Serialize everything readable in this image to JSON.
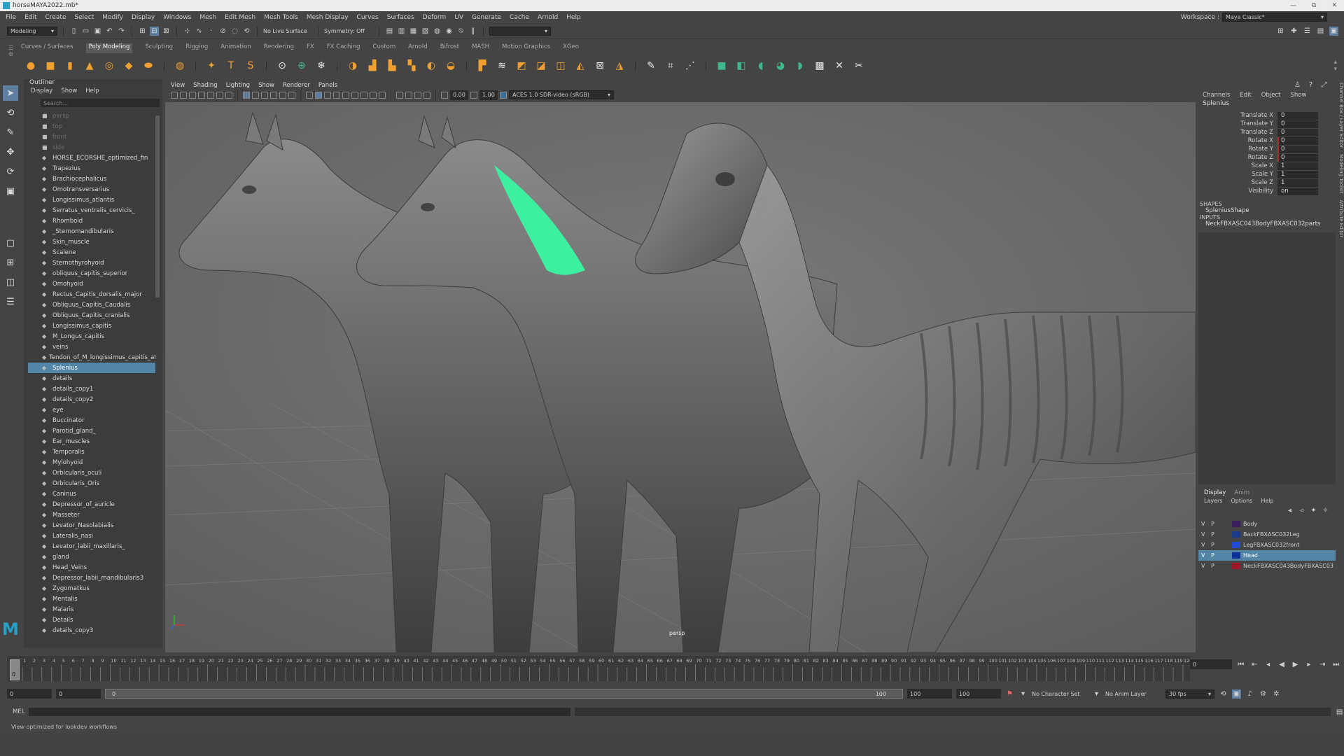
{
  "window": {
    "title": "horseMAYA2022.mb*",
    "controls": [
      "—",
      "⧉",
      "✕"
    ]
  },
  "menubar": {
    "items": [
      "File",
      "Edit",
      "Create",
      "Select",
      "Modify",
      "Display",
      "Windows",
      "Mesh",
      "Edit Mesh",
      "Mesh Tools",
      "Mesh Display",
      "Curves",
      "Surfaces",
      "Deform",
      "UV",
      "Generate",
      "Cache",
      "Arnold",
      "Help"
    ],
    "workspace_label": "Workspace :",
    "workspace_value": "Maya Classic*"
  },
  "statusline": {
    "mode": "Modeling",
    "live_surface": "No Live Surface",
    "symmetry": "Symmetry: Off"
  },
  "shelf": {
    "tabs": [
      "Curves / Surfaces",
      "Poly Modeling",
      "Sculpting",
      "Rigging",
      "Animation",
      "Rendering",
      "FX",
      "FX Caching",
      "Custom",
      "Arnold",
      "Bifrost",
      "MASH",
      "Motion Graphics",
      "XGen"
    ],
    "active_tab": "Poly Modeling"
  },
  "outliner": {
    "title": "Outliner",
    "menu": [
      "Display",
      "Show",
      "Help"
    ],
    "search_placeholder": "Search...",
    "items": [
      {
        "name": "persp",
        "kind": "camera",
        "dim": true
      },
      {
        "name": "top",
        "kind": "camera",
        "dim": true
      },
      {
        "name": "front",
        "kind": "camera",
        "dim": true
      },
      {
        "name": "side",
        "kind": "camera",
        "dim": true
      },
      {
        "name": "HORSE_ECORSHE_optimized_fin"
      },
      {
        "name": "Trapezius"
      },
      {
        "name": "Brachiocephalicus"
      },
      {
        "name": "Omotransversarius"
      },
      {
        "name": "Longissimus_atlantis"
      },
      {
        "name": "Serratus_ventralis_cervicis_"
      },
      {
        "name": "Rhomboid"
      },
      {
        "name": "_Sternomandibularis"
      },
      {
        "name": "Skin_muscle"
      },
      {
        "name": "Scalene"
      },
      {
        "name": "Sternothyrohyoid"
      },
      {
        "name": "obliquus_capitis_superior"
      },
      {
        "name": "Omohyoid"
      },
      {
        "name": "Rectus_Capitis_dorsalis_major"
      },
      {
        "name": "Obliquus_Capitis_Caudalis"
      },
      {
        "name": "Obliquus_Capitis_cranialis"
      },
      {
        "name": "Longissimus_capitis"
      },
      {
        "name": "M_Longus_capitis"
      },
      {
        "name": "veins"
      },
      {
        "name": "Tendon_of_M_longissimus_capitis_at"
      },
      {
        "name": "Splenius",
        "selected": true
      },
      {
        "name": "details"
      },
      {
        "name": "details_copy1"
      },
      {
        "name": "details_copy2"
      },
      {
        "name": "eye"
      },
      {
        "name": "Buccinator"
      },
      {
        "name": "Parotid_gland_"
      },
      {
        "name": "Ear_muscles"
      },
      {
        "name": "Temporalis"
      },
      {
        "name": "Mylohyoid"
      },
      {
        "name": "Orbicularis_oculi"
      },
      {
        "name": "Orbicularis_Oris"
      },
      {
        "name": "Caninus"
      },
      {
        "name": "Depressor_of_auricle"
      },
      {
        "name": "Masseter"
      },
      {
        "name": "Levator_Nasolabialis"
      },
      {
        "name": "Lateralis_nasi"
      },
      {
        "name": "Levator_labii_maxillaris_"
      },
      {
        "name": "gland"
      },
      {
        "name": "Head_Veins"
      },
      {
        "name": "Depressor_labii_mandibularis3"
      },
      {
        "name": "Zygomatkus"
      },
      {
        "name": "Mentalis"
      },
      {
        "name": "Malaris"
      },
      {
        "name": "Details"
      },
      {
        "name": "details_copy3"
      }
    ]
  },
  "viewport": {
    "menu": [
      "View",
      "Shading",
      "Lighting",
      "Show",
      "Renderer",
      "Panels"
    ],
    "exposure": "0.00",
    "gamma": "1.00",
    "color_transform": "ACES 1.0 SDR-video (sRGB)",
    "camera_label": "persp",
    "highlight_color": "#3df0a0"
  },
  "channelbox": {
    "menu": [
      "Channels",
      "Edit",
      "Object",
      "Show"
    ],
    "object": "Splenius",
    "attrs": [
      {
        "label": "Translate X",
        "value": "0",
        "keyed": false
      },
      {
        "label": "Translate Y",
        "value": "0",
        "keyed": false
      },
      {
        "label": "Translate Z",
        "value": "0",
        "keyed": false
      },
      {
        "label": "Rotate X",
        "value": "0",
        "keyed": true
      },
      {
        "label": "Rotate Y",
        "value": "0",
        "keyed": true
      },
      {
        "label": "Rotate Z",
        "value": "0",
        "keyed": true
      },
      {
        "label": "Scale X",
        "value": "1",
        "keyed": false
      },
      {
        "label": "Scale Y",
        "value": "1",
        "keyed": false
      },
      {
        "label": "Scale Z",
        "value": "1",
        "keyed": false
      },
      {
        "label": "Visibility",
        "value": "on",
        "keyed": false
      }
    ],
    "shapes_header": "SHAPES",
    "shape": "SpleniusShape",
    "inputs_header": "INPUTS",
    "input": "NeckFBXASC043BodyFBXASC032parts"
  },
  "sidetabs": [
    "Channel Box / Layer Editor",
    "Modeling Toolkit",
    "Attribute Editor"
  ],
  "layers": {
    "tabs": [
      "Display",
      "Anim"
    ],
    "menu": [
      "Layers",
      "Options",
      "Help"
    ],
    "rows": [
      {
        "name": "Body",
        "color": "#3a1f5e",
        "selected": false
      },
      {
        "name": "BackFBXASC032Leg",
        "color": "#1a3a8c",
        "selected": false
      },
      {
        "name": "LegFBXASC032front",
        "color": "#1f4bd6",
        "selected": false
      },
      {
        "name": "Head",
        "color": "#0f2f99",
        "selected": true
      },
      {
        "name": "NeckFBXASC043BodyFBXASC03",
        "color": "#a0162b",
        "selected": false
      }
    ]
  },
  "timeline": {
    "start": 1,
    "end": 120,
    "current": "0",
    "current_frame_field": "0"
  },
  "range": {
    "start": "0",
    "anim_start": "0",
    "range_start_label": "0",
    "range_end_label": "100",
    "end": "100",
    "anim_end": "100",
    "character_set": "No Character Set",
    "anim_layer": "No Anim Layer",
    "fps": "30 fps"
  },
  "mel": {
    "label": "MEL"
  },
  "help": {
    "text": "View optimized for lookdev workflows"
  }
}
